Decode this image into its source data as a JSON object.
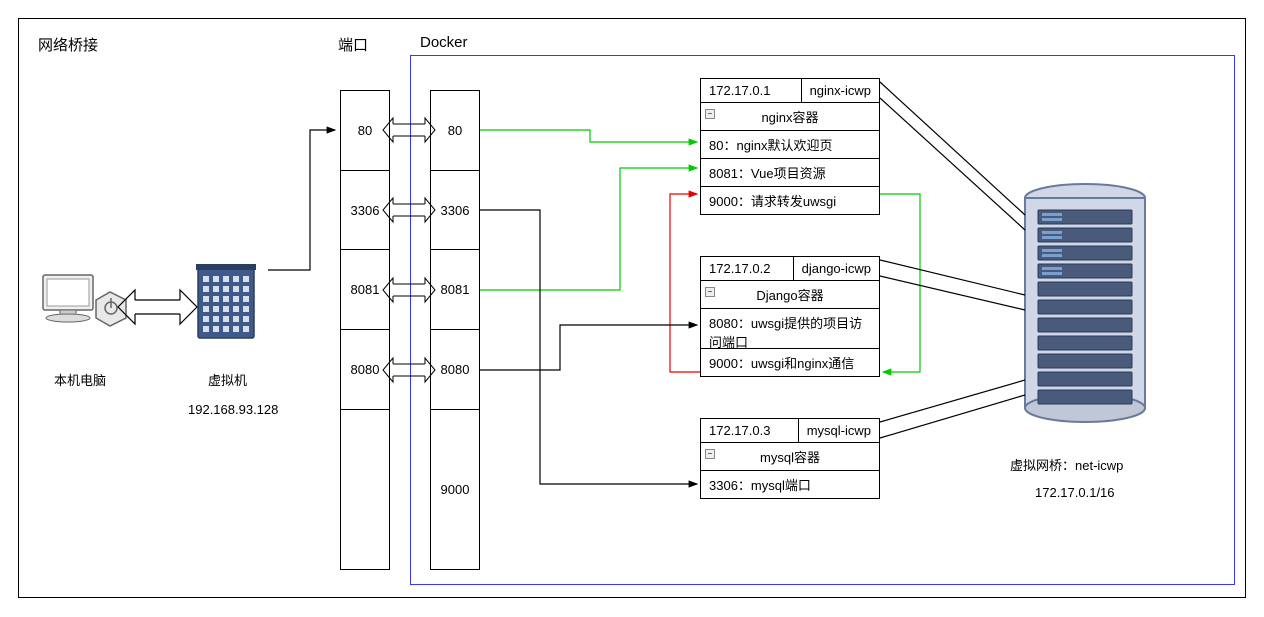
{
  "labels": {
    "bridge": "网络桥接",
    "port": "端口",
    "docker": "Docker",
    "local_pc": "本机电脑",
    "vm": "虚拟机",
    "vm_ip": "192.168.93.128",
    "virtual_bridge": "虚拟网桥：net-icwp",
    "bridge_cidr": "172.17.0.1/16"
  },
  "left_ports": [
    "80",
    "3306",
    "8081",
    "8080",
    ""
  ],
  "right_ports": [
    "80",
    "3306",
    "8081",
    "8080",
    "9000"
  ],
  "nginx": {
    "ip": "172.17.0.1",
    "name": "nginx-icwp",
    "title": "nginx容器",
    "row1": "80：nginx默认欢迎页",
    "row2": "8081：Vue项目资源",
    "row3": "9000：请求转发uwsgi"
  },
  "django": {
    "ip": "172.17.0.2",
    "name": "django-icwp",
    "title": "Django容器",
    "row1": "8080：uwsgi提供的项目访问端口",
    "row2": "9000：uwsgi和nginx通信"
  },
  "mysql": {
    "ip": "172.17.0.3",
    "name": "mysql-icwp",
    "title": "mysql容器",
    "row1": "3306：mysql端口"
  }
}
